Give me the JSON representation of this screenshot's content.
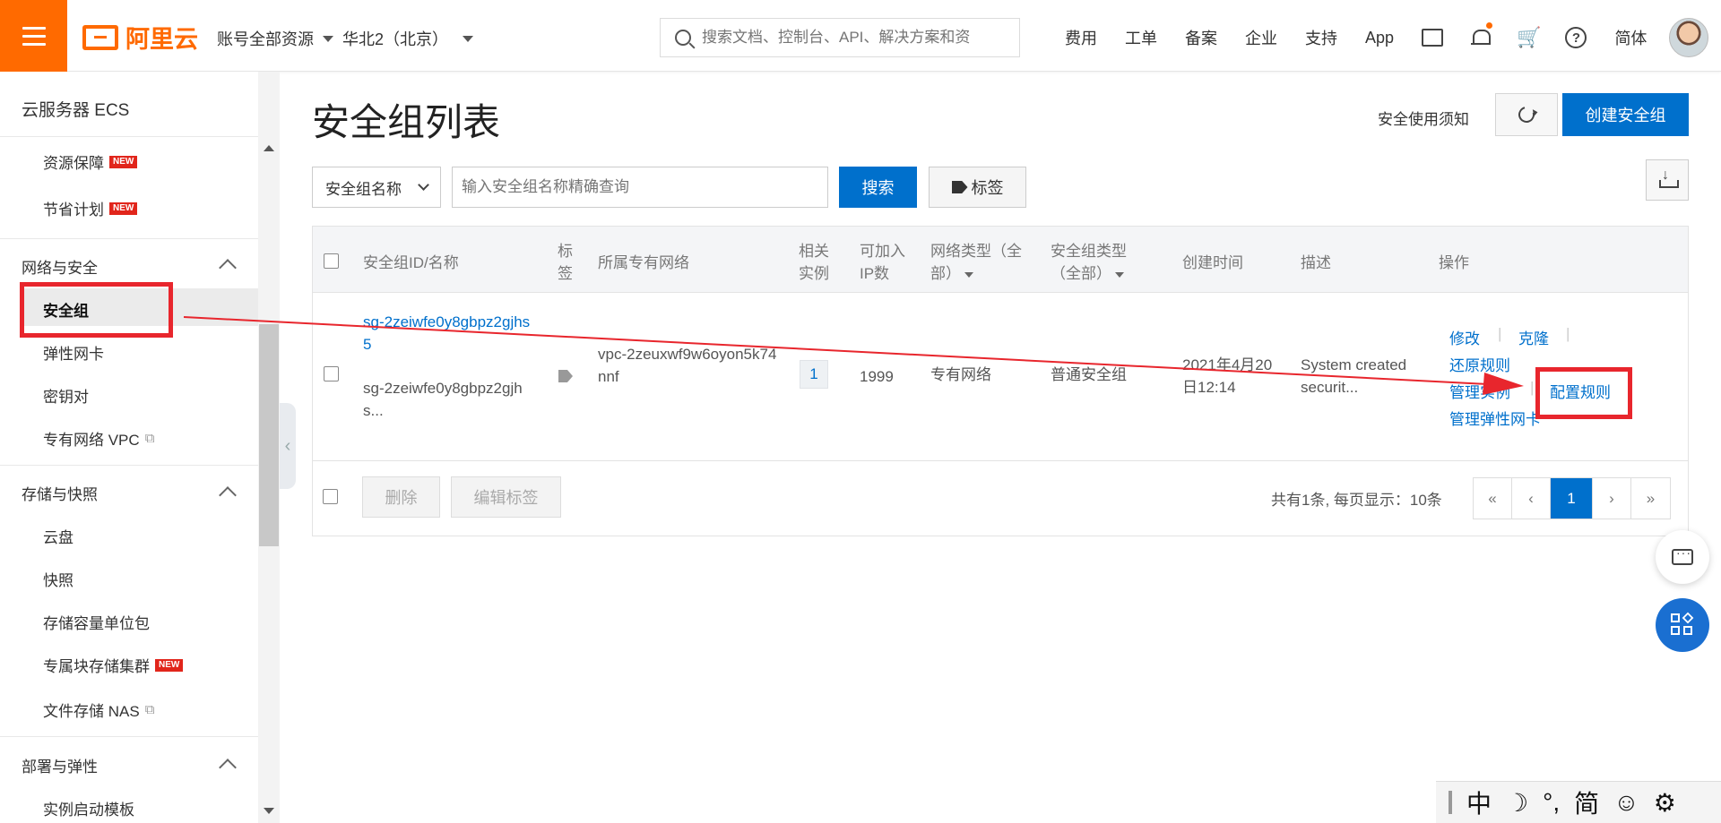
{
  "topbar": {
    "logo_text": "阿里云",
    "account": "账号全部资源",
    "region": "华北2（北京）",
    "search_placeholder": "搜索文档、控制台、API、解决方案和资",
    "nav": [
      "费用",
      "工单",
      "备案",
      "企业",
      "支持",
      "App"
    ],
    "lang": "简体",
    "help_glyph": "?",
    "cart_glyph": "🛒"
  },
  "sidebar": {
    "title": "云服务器 ECS",
    "items_top": [
      {
        "label": "资源保障",
        "badge": "NEW"
      },
      {
        "label": "节省计划",
        "badge": "NEW"
      }
    ],
    "group_network": "网络与安全",
    "network_items": [
      "安全组",
      "弹性网卡",
      "密钥对",
      "专有网络 VPC"
    ],
    "group_storage": "存储与快照",
    "storage_items": [
      "云盘",
      "快照",
      "存储容量单位包"
    ],
    "storage_item_dedicated": {
      "label": "专属块存储集群",
      "badge": "NEW"
    },
    "storage_item_nas": "文件存储 NAS",
    "group_deploy": "部署与弹性",
    "deploy_items": [
      "实例启动模板"
    ],
    "external_glyph": "⧉",
    "collapse_glyph": "‹"
  },
  "main": {
    "page_title": "安全组列表",
    "notice_link": "安全使用须知",
    "create_button": "创建安全组",
    "filter_select": "安全组名称",
    "query_placeholder": "输入安全组名称精确查询",
    "search_button": "搜索",
    "tag_button": "标签",
    "columns": {
      "id_name": "安全组ID/名称",
      "tag": "标签",
      "vpc": "所属专有网络",
      "instances": "相关实例",
      "ip_count": "可加入IP数",
      "net_type": "网络类型（全部）",
      "sg_type": "安全组类型（全部）",
      "created": "创建时间",
      "desc": "描述",
      "ops": "操作"
    },
    "row": {
      "sg_id": "sg-2zeiwfe0y8gbpz2gjhs5",
      "sg_name": "sg-2zeiwfe0y8gbpz2gjhs...",
      "vpc": "vpc-2zeuxwf9w6oyon5k74nnf",
      "instances": "1",
      "ip_count": "1999",
      "net_type": "专有网络",
      "sg_type": "普通安全组",
      "created": "2021年4月20日12:14",
      "desc": "System created securit...",
      "ops": {
        "modify": "修改",
        "clone": "克隆",
        "restore": "还原规则",
        "manage_instances": "管理实例",
        "configure_rules": "配置规则",
        "manage_eni": "管理弹性网卡"
      }
    },
    "footer": {
      "delete_button": "删除",
      "edit_tags_button": "编辑标签",
      "pager_info": "共有1条, 每页显示：10条",
      "pager": [
        "«",
        "‹",
        "1",
        "›",
        "»"
      ]
    }
  },
  "ime": {
    "items": [
      "中",
      "☽",
      "°,",
      "简",
      "☺",
      "⚙"
    ]
  },
  "colors": {
    "brand": "#ff6a00",
    "primary": "#0070cc",
    "annotation": "#e8262d"
  }
}
